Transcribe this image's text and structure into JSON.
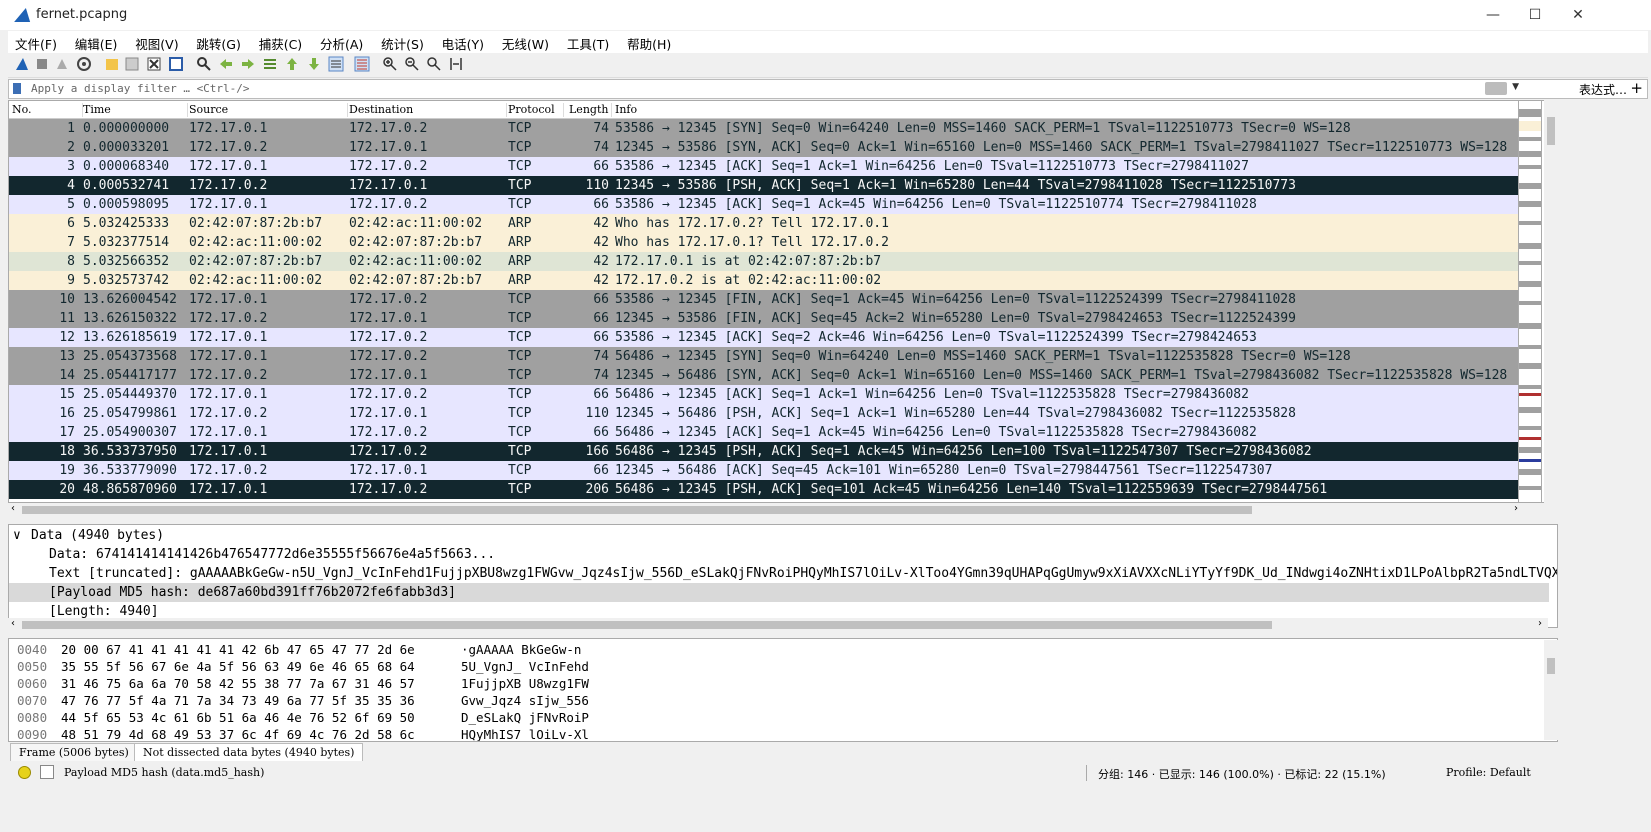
{
  "window": {
    "title": "fernet.pcapng",
    "minimize": "—",
    "maximize": "☐",
    "close": "✕"
  },
  "menu": [
    "文件(F)",
    "编辑(E)",
    "视图(V)",
    "跳转(G)",
    "捕获(C)",
    "分析(A)",
    "统计(S)",
    "电话(Y)",
    "无线(W)",
    "工具(T)",
    "帮助(H)"
  ],
  "filter": {
    "placeholder": "Apply a display filter … <Ctrl-/>",
    "expression_label": "表达式…",
    "add_label": "+"
  },
  "columns": {
    "no": "No.",
    "time": "Time",
    "source": "Source",
    "destination": "Destination",
    "protocol": "Protocol",
    "length": "Length",
    "info": "Info"
  },
  "colors": {
    "tcp_gray": "#a0a0a0",
    "tcp_light": "#e7e6ff",
    "selected": "#12272e",
    "arp_beige": "#faf0d7",
    "arp_green": "#dfe5d5"
  },
  "packets": [
    {
      "no": "1",
      "time": "0.000000000",
      "src": "172.17.0.1",
      "dst": "172.17.0.2",
      "proto": "TCP",
      "len": "74",
      "info": "53586 → 12345 [SYN] Seq=0 Win=64240 Len=0 MSS=1460 SACK_PERM=1 TSval=1122510773 TSecr=0 WS=128",
      "style": "gray"
    },
    {
      "no": "2",
      "time": "0.000033201",
      "src": "172.17.0.2",
      "dst": "172.17.0.1",
      "proto": "TCP",
      "len": "74",
      "info": "12345 → 53586 [SYN, ACK] Seq=0 Ack=1 Win=65160 Len=0 MSS=1460 SACK_PERM=1 TSval=2798411027 TSecr=1122510773 WS=128",
      "style": "gray"
    },
    {
      "no": "3",
      "time": "0.000068340",
      "src": "172.17.0.1",
      "dst": "172.17.0.2",
      "proto": "TCP",
      "len": "66",
      "info": "53586 → 12345 [ACK] Seq=1 Ack=1 Win=64256 Len=0 TSval=1122510773 TSecr=2798411027",
      "style": "light"
    },
    {
      "no": "4",
      "time": "0.000532741",
      "src": "172.17.0.2",
      "dst": "172.17.0.1",
      "proto": "TCP",
      "len": "110",
      "info": "12345 → 53586 [PSH, ACK] Seq=1 Ack=1 Win=65280 Len=44 TSval=2798411028 TSecr=1122510773",
      "style": "dark"
    },
    {
      "no": "5",
      "time": "0.000598095",
      "src": "172.17.0.1",
      "dst": "172.17.0.2",
      "proto": "TCP",
      "len": "66",
      "info": "53586 → 12345 [ACK] Seq=1 Ack=45 Win=64256 Len=0 TSval=1122510774 TSecr=2798411028",
      "style": "light"
    },
    {
      "no": "6",
      "time": "5.032425333",
      "src": "02:42:07:87:2b:b7",
      "dst": "02:42:ac:11:00:02",
      "proto": "ARP",
      "len": "42",
      "info": "Who has 172.17.0.2? Tell 172.17.0.1",
      "style": "beige"
    },
    {
      "no": "7",
      "time": "5.032377514",
      "src": "02:42:ac:11:00:02",
      "dst": "02:42:07:87:2b:b7",
      "proto": "ARP",
      "len": "42",
      "info": "Who has 172.17.0.1? Tell 172.17.0.2",
      "style": "beige"
    },
    {
      "no": "8",
      "time": "5.032566352",
      "src": "02:42:07:87:2b:b7",
      "dst": "02:42:ac:11:00:02",
      "proto": "ARP",
      "len": "42",
      "info": "172.17.0.1 is at 02:42:07:87:2b:b7",
      "style": "green"
    },
    {
      "no": "9",
      "time": "5.032573742",
      "src": "02:42:ac:11:00:02",
      "dst": "02:42:07:87:2b:b7",
      "proto": "ARP",
      "len": "42",
      "info": "172.17.0.2 is at 02:42:ac:11:00:02",
      "style": "beige"
    },
    {
      "no": "10",
      "time": "13.626004542",
      "src": "172.17.0.1",
      "dst": "172.17.0.2",
      "proto": "TCP",
      "len": "66",
      "info": "53586 → 12345 [FIN, ACK] Seq=1 Ack=45 Win=64256 Len=0 TSval=1122524399 TSecr=2798411028",
      "style": "gray"
    },
    {
      "no": "11",
      "time": "13.626150322",
      "src": "172.17.0.2",
      "dst": "172.17.0.1",
      "proto": "TCP",
      "len": "66",
      "info": "12345 → 53586 [FIN, ACK] Seq=45 Ack=2 Win=65280 Len=0 TSval=2798424653 TSecr=1122524399",
      "style": "gray"
    },
    {
      "no": "12",
      "time": "13.626185619",
      "src": "172.17.0.1",
      "dst": "172.17.0.2",
      "proto": "TCP",
      "len": "66",
      "info": "53586 → 12345 [ACK] Seq=2 Ack=46 Win=64256 Len=0 TSval=1122524399 TSecr=2798424653",
      "style": "light"
    },
    {
      "no": "13",
      "time": "25.054373568",
      "src": "172.17.0.1",
      "dst": "172.17.0.2",
      "proto": "TCP",
      "len": "74",
      "info": "56486 → 12345 [SYN] Seq=0 Win=64240 Len=0 MSS=1460 SACK_PERM=1 TSval=1122535828 TSecr=0 WS=128",
      "style": "gray"
    },
    {
      "no": "14",
      "time": "25.054417177",
      "src": "172.17.0.2",
      "dst": "172.17.0.1",
      "proto": "TCP",
      "len": "74",
      "info": "12345 → 56486 [SYN, ACK] Seq=0 Ack=1 Win=65160 Len=0 MSS=1460 SACK_PERM=1 TSval=2798436082 TSecr=1122535828 WS=128",
      "style": "gray"
    },
    {
      "no": "15",
      "time": "25.054449370",
      "src": "172.17.0.1",
      "dst": "172.17.0.2",
      "proto": "TCP",
      "len": "66",
      "info": "56486 → 12345 [ACK] Seq=1 Ack=1 Win=64256 Len=0 TSval=1122535828 TSecr=2798436082",
      "style": "light"
    },
    {
      "no": "16",
      "time": "25.054799861",
      "src": "172.17.0.2",
      "dst": "172.17.0.1",
      "proto": "TCP",
      "len": "110",
      "info": "12345 → 56486 [PSH, ACK] Seq=1 Ack=1 Win=65280 Len=44 TSval=2798436082 TSecr=1122535828",
      "style": "light"
    },
    {
      "no": "17",
      "time": "25.054900307",
      "src": "172.17.0.1",
      "dst": "172.17.0.2",
      "proto": "TCP",
      "len": "66",
      "info": "56486 → 12345 [ACK] Seq=1 Ack=45 Win=64256 Len=0 TSval=1122535828 TSecr=2798436082",
      "style": "light"
    },
    {
      "no": "18",
      "time": "36.533737950",
      "src": "172.17.0.1",
      "dst": "172.17.0.2",
      "proto": "TCP",
      "len": "166",
      "info": "56486 → 12345 [PSH, ACK] Seq=1 Ack=45 Win=64256 Len=100 TSval=1122547307 TSecr=2798436082",
      "style": "dark"
    },
    {
      "no": "19",
      "time": "36.533779090",
      "src": "172.17.0.2",
      "dst": "172.17.0.1",
      "proto": "TCP",
      "len": "66",
      "info": "12345 → 56486 [ACK] Seq=45 Ack=101 Win=65280 Len=0 TSval=2798447561 TSecr=1122547307",
      "style": "light"
    },
    {
      "no": "20",
      "time": "48.865870960",
      "src": "172.17.0.1",
      "dst": "172.17.0.2",
      "proto": "TCP",
      "len": "206",
      "info": "56486 → 12345 [PSH, ACK] Seq=101 Ack=45 Win=64256 Len=140 TSval=1122559639 TSecr=2798447561",
      "style": "dark"
    }
  ],
  "details": [
    {
      "text": "Data (4940 bytes)",
      "expander": "∨",
      "indent": 0,
      "selected": false
    },
    {
      "text": "Data: 674141414141426b476547772d6e35555f56676e4a5f5663...",
      "expander": "",
      "indent": 1,
      "selected": false
    },
    {
      "text": "Text [truncated]: gAAAAABkGeGw-n5U_VgnJ_VcInFehd1FujjpXBU8wzg1FWGvw_Jqz4sIjw_556D_eSLakQjFNvRoiPHQyMhIS7lOiLv-XlToo4YGmn39qUHAPqGgUmyw9xXiAVXXcNLiYTyYf9DK_Ud_INdwgi4oZNHtixD1LPoAlbpR2Ta5ndLTVQXphx",
      "expander": "",
      "indent": 1,
      "selected": false
    },
    {
      "text": "[Payload MD5 hash: de687a60bd391ff76b2072fe6fabb3d3]",
      "expander": "",
      "indent": 1,
      "selected": true
    },
    {
      "text": "[Length: 4940]",
      "expander": "",
      "indent": 1,
      "selected": false
    }
  ],
  "bytes": [
    {
      "offset": "0040",
      "hex": "20 00 67 41 41 41 41 41  42 6b 47 65 47 77 2d 6e",
      "ascii": " ·gAAAAA BkGeGw-n"
    },
    {
      "offset": "0050",
      "hex": "35 55 5f 56 67 6e 4a 5f  56 63 49 6e 46 65 68 64",
      "ascii": "5U_VgnJ_ VcInFehd"
    },
    {
      "offset": "0060",
      "hex": "31 46 75 6a 6a 70 58 42  55 38 77 7a 67 31 46 57",
      "ascii": "1FujjpXB U8wzg1FW"
    },
    {
      "offset": "0070",
      "hex": "47 76 77 5f 4a 71 7a 34  73 49 6a 77 5f 35 35 36",
      "ascii": "Gvw_Jqz4 sIjw_556"
    },
    {
      "offset": "0080",
      "hex": "44 5f 65 53 4c 61 6b 51  6a 46 4e 76 52 6f 69 50",
      "ascii": "D_eSLakQ jFNvRoiP"
    },
    {
      "offset": "0090",
      "hex": "48 51 79 4d 68 49 53 37  6c 4f 69 4c 76 2d 58 6c",
      "ascii": "HQyMhIS7 lOiLv-Xl"
    }
  ],
  "byte_tabs": [
    "Frame (5006 bytes)",
    "Not dissected data bytes (4940 bytes)"
  ],
  "status": {
    "field": "Payload MD5 hash (data.md5_hash)",
    "stats": "分组: 146 · 已显示: 146 (100.0%) · 已标记: 22 (15.1%)",
    "profile": "Profile: Default"
  }
}
